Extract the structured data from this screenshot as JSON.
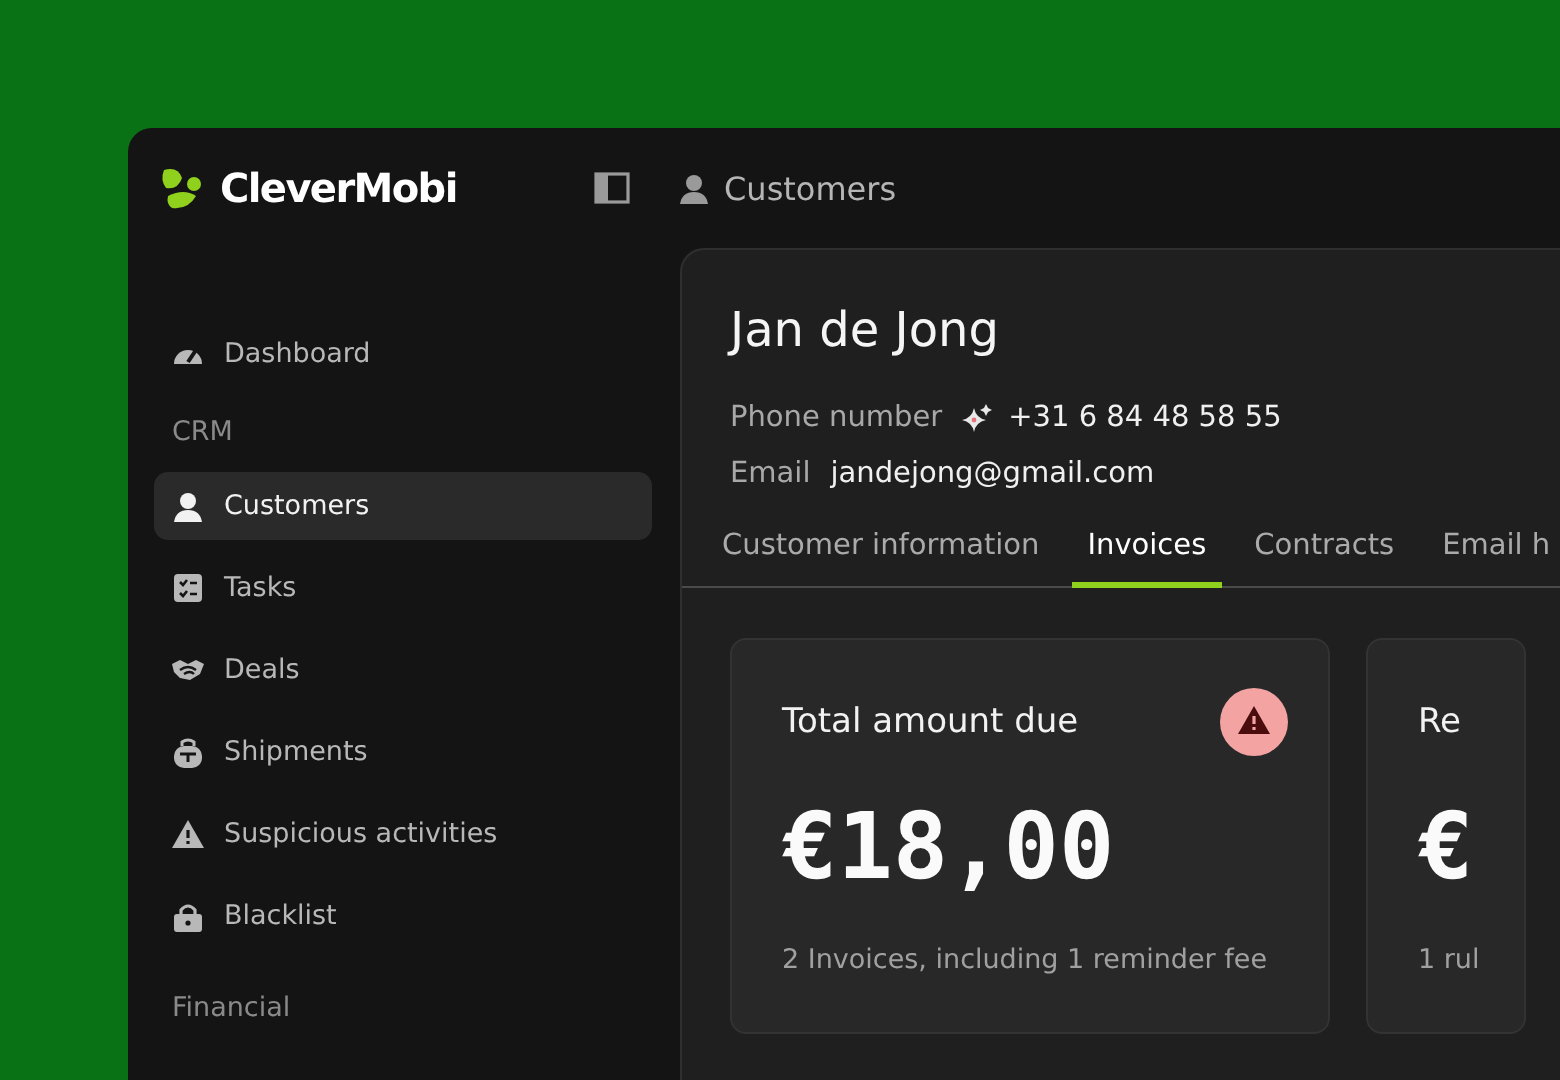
{
  "app": {
    "logo_text": "CleverMobi"
  },
  "breadcrumb": {
    "label": "Customers"
  },
  "sidebar": {
    "items": [
      {
        "kind": "item",
        "label": "Dashboard",
        "selected": false
      },
      {
        "kind": "section",
        "label": "CRM"
      },
      {
        "kind": "item",
        "label": "Customers",
        "selected": true
      },
      {
        "kind": "item",
        "label": "Tasks",
        "selected": false
      },
      {
        "kind": "item",
        "label": "Deals",
        "selected": false
      },
      {
        "kind": "item",
        "label": "Shipments",
        "selected": false
      },
      {
        "kind": "item",
        "label": "Suspicious activities",
        "selected": false
      },
      {
        "kind": "item",
        "label": "Blacklist",
        "selected": false
      },
      {
        "kind": "section",
        "label": "Financial"
      }
    ]
  },
  "customer": {
    "name": "Jan de Jong",
    "fields": [
      {
        "label": "Phone number",
        "value": "+31 6 84 48 58 55",
        "verified": true
      },
      {
        "label": "Email",
        "value": "jandejong@gmail.com",
        "verified": false
      }
    ]
  },
  "tabs": [
    {
      "label": "Customer information",
      "selected": false
    },
    {
      "label": "Invoices",
      "selected": true
    },
    {
      "label": "Contracts",
      "selected": false
    },
    {
      "label": "Email h",
      "selected": false
    }
  ],
  "cards": [
    {
      "title": "Total amount due",
      "amount": "€18,00",
      "note": "2 Invoices, including 1 reminder fee",
      "warning": true
    },
    {
      "title": "Re",
      "amount": "€",
      "note": "1 rul",
      "warning": false
    }
  ]
}
